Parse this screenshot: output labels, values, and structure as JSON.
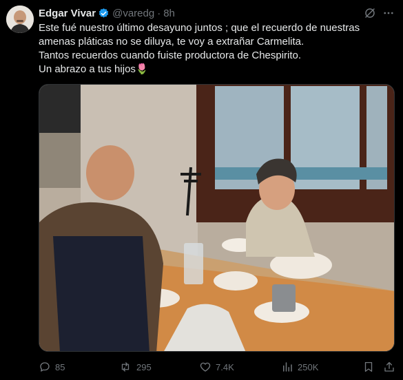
{
  "tweet": {
    "author_name": "Edgar Vivar",
    "handle": "@varedg",
    "separator": "·",
    "time": "8h",
    "text_lines": [
      "Este fué nuestro último desayuno juntos ; que el recuerdo de nuestras",
      "amenas pláticas no se diluya, te voy a extrañar Carmelita.",
      "Tantos recuerdos cuando fuiste productora de Chespirito.",
      "Un abrazo a tus hijos🌷"
    ]
  },
  "actions": {
    "replies": "85",
    "reposts": "295",
    "likes": "7.4K",
    "views": "250K"
  },
  "colors": {
    "background": "#000000",
    "text": "#e7e9ea",
    "muted": "#71767b",
    "verified": "#1d9bf0"
  },
  "icons": [
    "verified-badge-icon",
    "grok-icon",
    "more-icon",
    "reply-icon",
    "repost-icon",
    "like-icon",
    "views-icon",
    "bookmark-icon",
    "share-icon"
  ]
}
